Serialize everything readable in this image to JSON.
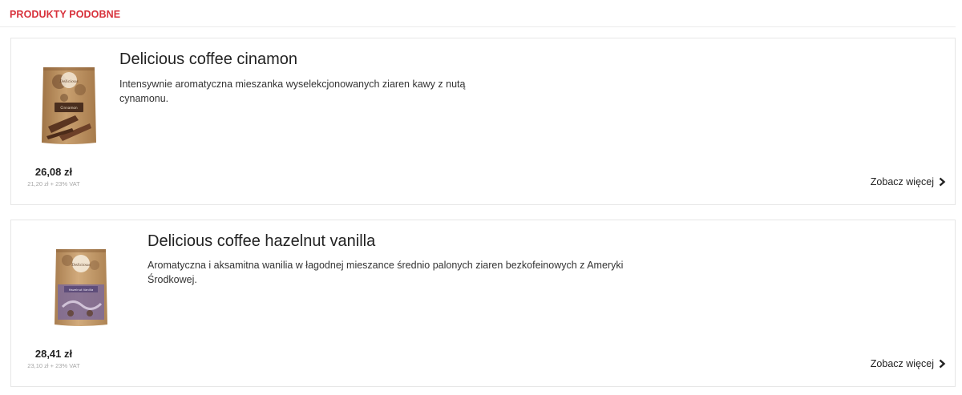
{
  "section": {
    "title": "PRODUKTY PODOBNE"
  },
  "products": [
    {
      "name": "Delicious coffee cinamon",
      "description": "Intensywnie aromatyczna mieszanka wyselekcjonowanych ziaren kawy z nutą cynamonu.",
      "price": "26,08 zł",
      "net_price": "21,20 zł + 23% VAT",
      "more_label": "Zobacz więcej",
      "image": {
        "brand_text": "Delicious",
        "label_text": "Cinnamon",
        "pack_color": "#c19463",
        "label_color": "#4a2e1e"
      }
    },
    {
      "name": "Delicious coffee hazelnut vanilla",
      "description": "Aromatyczna i aksamitna wanilia w łagodnej mieszance średnio palonych ziaren bezkofeinowych z Ameryki Środkowej.",
      "price": "28,41 zł",
      "net_price": "23,10 zł + 23% VAT",
      "more_label": "Zobacz więcej",
      "image": {
        "brand_text": "Delicious",
        "label_text": "Hazelnut Vanilla",
        "pack_color": "#c59a6a",
        "label_color": "#7d6a98"
      }
    }
  ],
  "colors": {
    "accent": "#d8323c",
    "text": "#333333",
    "muted": "#a6a6a6",
    "border": "#e6e6e6"
  },
  "icons": {
    "more": "chevron-right-icon"
  }
}
